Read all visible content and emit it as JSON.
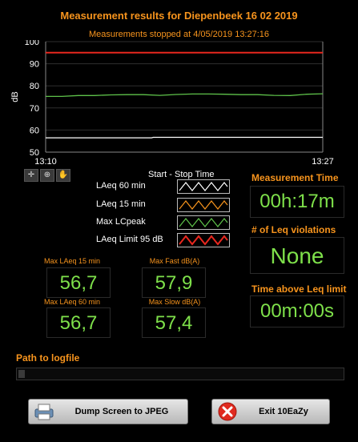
{
  "header": {
    "title": "Measurement results for Diepenbeek 16 02 2019",
    "subtitle": "Measurements stopped at 4/05/2019 13:27:16"
  },
  "chart_data": {
    "type": "line",
    "ylabel": "dB",
    "xlabel": "",
    "ylim": [
      50,
      100
    ],
    "yticks": [
      "50",
      "60",
      "70",
      "80",
      "90",
      "100"
    ],
    "xticks": [
      "13:10",
      "13:27"
    ],
    "grid": true,
    "x": [
      0,
      17
    ],
    "series": [
      {
        "name": "LAeq Limit 95 dB",
        "color": "#e8271e",
        "values": [
          [
            0,
            95
          ],
          [
            17,
            95
          ]
        ]
      },
      {
        "name": "LAeq 15 min",
        "color": "#5ec24a",
        "values": [
          [
            0,
            75.2
          ],
          [
            1,
            75.2
          ],
          [
            2,
            75.6
          ],
          [
            3,
            75.6
          ],
          [
            4,
            75.9
          ],
          [
            5,
            76
          ],
          [
            6,
            76
          ],
          [
            7,
            75.7
          ],
          [
            8,
            76.1
          ],
          [
            9,
            76.3
          ],
          [
            10,
            76.3
          ],
          [
            11,
            76.2
          ],
          [
            12,
            76
          ],
          [
            13,
            76
          ],
          [
            14,
            75.7
          ],
          [
            15,
            75.6
          ],
          [
            16,
            76.2
          ],
          [
            17,
            76.4
          ]
        ]
      },
      {
        "name": "LAeq 60 min",
        "color": "#ffffff",
        "values": [
          [
            0,
            56.5
          ],
          [
            6.5,
            56.5
          ],
          [
            6.6,
            56.7
          ],
          [
            17,
            56.7
          ]
        ]
      }
    ]
  },
  "toolbar": {
    "stop_time_label": "Start - Stop Time"
  },
  "legend": [
    {
      "label": "LAeq 60 min",
      "color": "#ffffff"
    },
    {
      "label": "LAeq 15 min",
      "color": "#f7941d"
    },
    {
      "label": "Max LCpeak",
      "color": "#5ec24a"
    },
    {
      "label": "LAeq Limit 95 dB",
      "color": "#e8271e"
    }
  ],
  "stats": {
    "max_laeq15_label": "Max LAeq 15 min",
    "max_laeq15_value": "56,7",
    "max_fast_label": "Max Fast dB(A)",
    "max_fast_value": "57,9",
    "max_laeq60_label": "Max LAeq 60 min",
    "max_laeq60_value": "56,7",
    "max_slow_label": "Max  Slow dB(A)",
    "max_slow_value": "57,4"
  },
  "right_panel": {
    "measurement_time_label": "Measurement Time",
    "measurement_time_value": "00h:17m",
    "violations_label": "# of Leq violations",
    "violations_value": "None",
    "time_above_label": "Time above Leq limit",
    "time_above_value": "00m:00s"
  },
  "logfile": {
    "label": "Path to logfile",
    "value": ""
  },
  "buttons": {
    "dump_label": "Dump Screen to JPEG",
    "exit_label": "Exit 10EaZy"
  },
  "colors": {
    "accent": "#f7941d",
    "value_green": "#7ee04a",
    "limit_red": "#e8271e"
  }
}
